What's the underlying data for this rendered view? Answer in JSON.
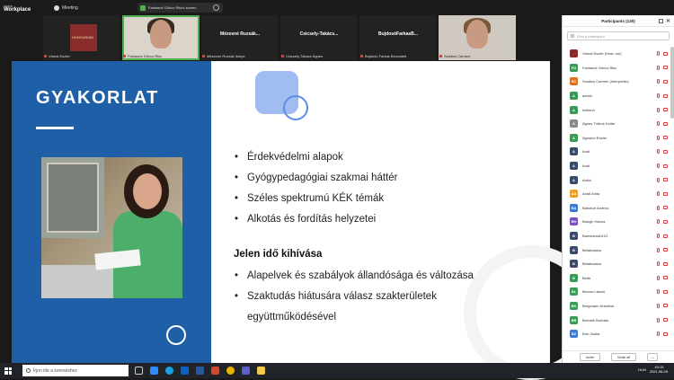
{
  "app": {
    "brand_line1": "zoom",
    "brand_line2": "Workplace",
    "meeting_label": "Meeting"
  },
  "share": {
    "label": "Farkasné Göncz Rita's screen"
  },
  "thumbnails": [
    {
      "name": "Vámai Eszter",
      "kind": "logo",
      "logo_text": "HUNGARIAN"
    },
    {
      "name": "Farkasné Göncz Rita",
      "kind": "video",
      "active": true
    },
    {
      "name": "Mézesné Ruzsák Ibolya",
      "kind": "name",
      "big": "Mézesné  Ruzsák..."
    },
    {
      "name": "Csicsely-Takács Ágnes",
      "kind": "name",
      "big": "Csicsely-Takács..."
    },
    {
      "name": "Bujdosó Farkas Bernadett",
      "kind": "name",
      "big": "BujdosóFarkasB..."
    },
    {
      "name": "Szadics Carmen",
      "kind": "video"
    }
  ],
  "slide": {
    "title": "GYAKORLAT",
    "bullets1": [
      "Érdekvédelmi alapok",
      "Gyógypedagógiai szakmai háttér",
      "Széles spektrumú KÉK témák",
      "Alkotás és fordítás helyzetei"
    ],
    "section_title": "Jelen idő kihívása",
    "bullets2": [
      "Alapelvek és szabályok állandósága és változása",
      "Szaktudás hiátusára válasz szakterületek"
    ],
    "bullets2_cont": "együttműködésével"
  },
  "participants": {
    "title": "Participants (130)",
    "search_placeholder": "Find a participant",
    "invite": "Invite",
    "mute_all": "Mute all",
    "more": "...",
    "list": [
      {
        "initials": "",
        "name": "Vámai Eszter (Host, me)",
        "color": "#8b2c2c"
      },
      {
        "initials": "FG",
        "name": "Farkasné Göncz Rita",
        "color": "#3a9a56"
      },
      {
        "initials": "SC",
        "name": "Szadics Carmen (Interpreter)",
        "color": "#e07020"
      },
      {
        "initials": "A",
        "name": "admin",
        "color": "#3a9a56"
      },
      {
        "initials": "A",
        "name": "Adrienn",
        "color": "#3a9a56"
      },
      {
        "initials": "Á",
        "name": "Ágnes Tóthné Kollár",
        "color": "#888888"
      },
      {
        "initials": "Á",
        "name": "Ágoston Eszter",
        "color": "#3a9a56"
      },
      {
        "initials": "A",
        "name": "Andi",
        "color": "#3a4a6a"
      },
      {
        "initials": "A",
        "name": "Andi",
        "color": "#3a4a6a"
      },
      {
        "initials": "A",
        "name": "Anikó",
        "color": "#3a4a6a"
      },
      {
        "initials": "AA",
        "name": "Antal Anita",
        "color": "#f0a020"
      },
      {
        "initials": "BA",
        "name": "Babolczi Andrea",
        "color": "#3a7ad0"
      },
      {
        "initials": "BH",
        "name": "Balogh Hanna",
        "color": "#7a50c0"
      },
      {
        "initials": "B",
        "name": "Bamadona0101",
        "color": "#3a4a6a"
      },
      {
        "initials": "B",
        "name": "Bélabcsaba",
        "color": "#3a4a6a"
      },
      {
        "initials": "B",
        "name": "Bélabcsaba",
        "color": "#3a4a6a"
      },
      {
        "initials": "B",
        "name": "Bella",
        "color": "#3a9a56"
      },
      {
        "initials": "BL",
        "name": "Bercsa László",
        "color": "#3a9a56"
      },
      {
        "initials": "BK",
        "name": "Bergmann Krisztina",
        "color": "#3a9a56"
      },
      {
        "initials": "BB",
        "name": "Bernáth Borbála",
        "color": "#3a9a56"
      },
      {
        "initials": "BZ",
        "name": "Bíró Zsófia",
        "color": "#3a7ad0"
      }
    ]
  },
  "taskbar": {
    "search_placeholder": "Írjon ide a kereséshez",
    "time": "10:15",
    "date": "2021.06.09.",
    "lang": "HUN"
  }
}
